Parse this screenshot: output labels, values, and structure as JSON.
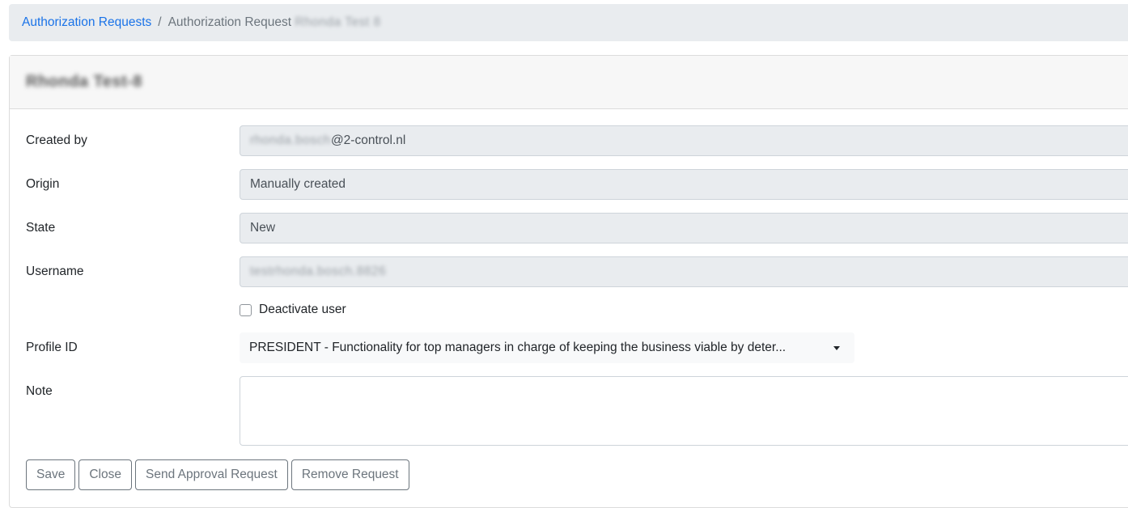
{
  "breadcrumb": {
    "parent_label": "Authorization Requests",
    "separator": "/",
    "current_label": "Authorization Request",
    "current_suffix_redacted": "Rhonda Test 8"
  },
  "card": {
    "title_redacted": "Rhonda Test-8"
  },
  "form": {
    "created_by": {
      "label": "Created by",
      "value_redacted_prefix": "rhonda.bosch",
      "value_suffix": "@2-control.nl"
    },
    "origin": {
      "label": "Origin",
      "value": "Manually created"
    },
    "state": {
      "label": "State",
      "value": "New"
    },
    "username": {
      "label": "Username",
      "value_redacted": "testrhonda.bosch.8826"
    },
    "deactivate_user": {
      "label": "Deactivate user",
      "checked": false
    },
    "profile_id": {
      "label": "Profile ID",
      "selected": "PRESIDENT - Functionality for top managers in charge of keeping the business viable by deter..."
    },
    "note": {
      "label": "Note",
      "value": ""
    }
  },
  "actions": {
    "save": "Save",
    "close": "Close",
    "send_approval": "Send Approval Request",
    "remove": "Remove Request"
  }
}
